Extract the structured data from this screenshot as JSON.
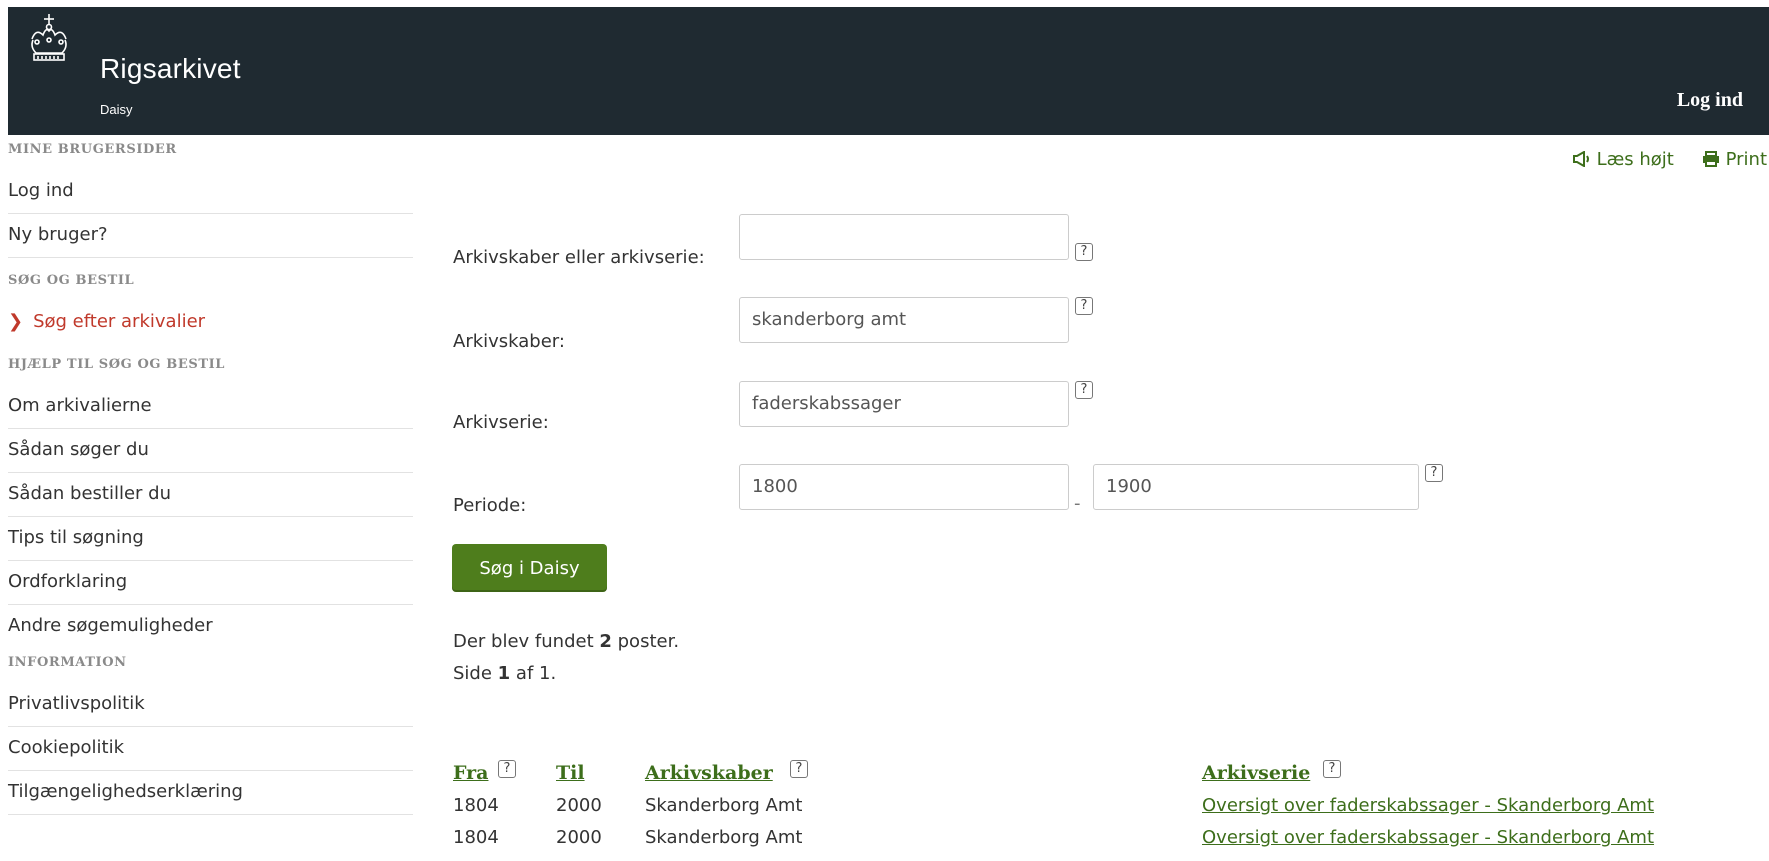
{
  "header": {
    "brand": "Rigsarkivet",
    "subtitle": "Daisy",
    "login": "Log ind",
    "logo_icon": "crown-icon",
    "bg_color": "#1f2a31"
  },
  "tools": {
    "read_aloud": "Læs højt",
    "print": "Print"
  },
  "sidebar": {
    "section1": "MINE BRUGERSIDER",
    "login": "Log ind",
    "new_user": "Ny bruger?",
    "section2": "SØG OG BESTIL",
    "search_item": "Søg efter arkivalier",
    "section3": "HJÆLP TIL SØG OG BESTIL",
    "help_items": [
      "Om arkivalierne",
      "Sådan søger du",
      "Sådan bestiller du",
      "Tips til søgning",
      "Ordforklaring",
      "Andre søgemuligheder"
    ],
    "section4": "INFORMATION",
    "info_items": [
      "Privatlivspolitik",
      "Cookiepolitik",
      "Tilgængelighedserklæring"
    ]
  },
  "form": {
    "creator_or_series_label": "Arkivskaber eller arkivserie:",
    "creator_or_series_value": "",
    "creator_label": "Arkivskaber:",
    "creator_value": "skanderborg amt",
    "series_label": "Arkivserie:",
    "series_value": "faderskabssager",
    "period_label": "Periode:",
    "period_from": "1800",
    "period_sep": "-",
    "period_to": "1900",
    "help_glyph": "?",
    "search_button": "Søg i Daisy"
  },
  "results": {
    "found_prefix": "Der blev fundet ",
    "found_count": "2",
    "found_suffix": " poster.",
    "page_prefix": "Side ",
    "page_current": "1",
    "page_suffix": " af 1."
  },
  "table": {
    "headers": {
      "from": "Fra",
      "to": "Til",
      "creator": "Arkivskaber",
      "series": "Arkivserie"
    },
    "rows": [
      {
        "from": "1804",
        "to": "2000",
        "creator": "Skanderborg Amt",
        "series": "Oversigt over faderskabssager - Skanderborg Amt"
      },
      {
        "from": "1804",
        "to": "2000",
        "creator": "Skanderborg Amt",
        "series": "Oversigt over faderskabssager - Skanderborg Amt"
      }
    ]
  },
  "colors": {
    "accent_green": "#4e7d1c",
    "link_green": "#3d6e1b",
    "active_red": "#c0392b"
  }
}
